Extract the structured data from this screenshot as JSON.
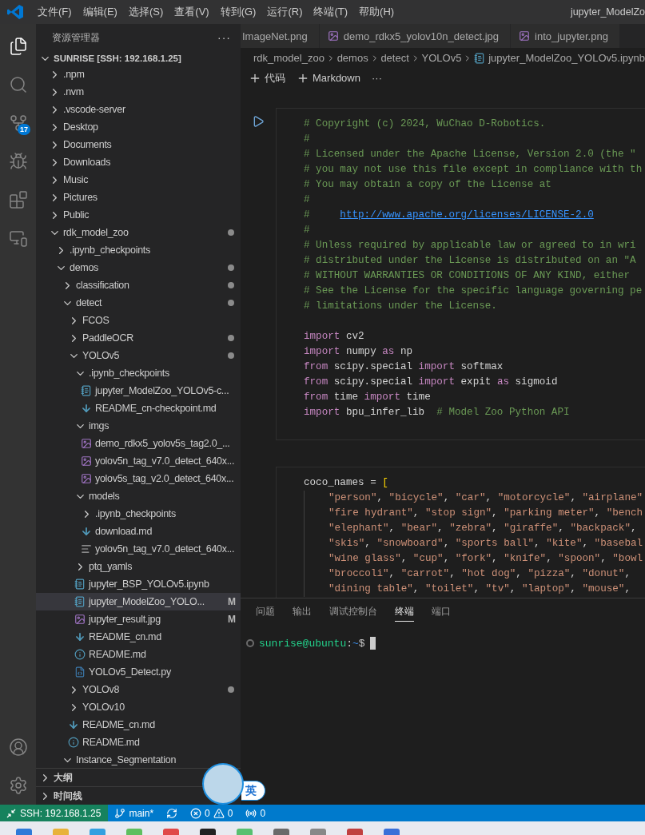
{
  "title_bar": {
    "menus": [
      "文件(F)",
      "编辑(E)",
      "选择(S)",
      "查看(V)",
      "转到(G)",
      "运行(R)",
      "终端(T)",
      "帮助(H)"
    ],
    "title": "jupyter_ModelZo"
  },
  "activity_bar": {
    "top": [
      {
        "kind": "explorer",
        "selected": true
      },
      {
        "kind": "search",
        "selected": false
      },
      {
        "kind": "source-control",
        "selected": false,
        "badge": "17"
      },
      {
        "kind": "run-debug",
        "selected": false
      },
      {
        "kind": "extensions",
        "selected": false
      },
      {
        "kind": "remote",
        "selected": false
      }
    ],
    "bottom": [
      {
        "kind": "account",
        "selected": false
      },
      {
        "kind": "settings",
        "selected": false
      }
    ]
  },
  "sidebar": {
    "title": "资源管理器",
    "more": "···",
    "section": "SUNRISE [SSH: 192.168.1.25]",
    "tree": [
      {
        "name": ".npm",
        "kind": "folder",
        "expanded": false,
        "modified": false,
        "selected": false
      },
      {
        "name": ".nvm",
        "kind": "folder",
        "expanded": false,
        "modified": false,
        "selected": false
      },
      {
        "name": ".vscode-server",
        "kind": "folder",
        "expanded": false,
        "modified": false,
        "selected": false
      },
      {
        "name": "Desktop",
        "kind": "folder",
        "expanded": false,
        "modified": false,
        "selected": false
      },
      {
        "name": "Documents",
        "kind": "folder",
        "expanded": false,
        "modified": false,
        "selected": false
      },
      {
        "name": "Downloads",
        "kind": "folder",
        "expanded": false,
        "modified": false,
        "selected": false
      },
      {
        "name": "Music",
        "kind": "folder",
        "expanded": false,
        "modified": false,
        "selected": false
      },
      {
        "name": "Pictures",
        "kind": "folder",
        "expanded": false,
        "modified": false,
        "selected": false
      },
      {
        "name": "Public",
        "kind": "folder",
        "expanded": false,
        "modified": false,
        "selected": false
      },
      {
        "name": "rdk_model_zoo",
        "kind": "folder",
        "expanded": true,
        "modified": true,
        "selected": false,
        "children": [
          {
            "name": ".ipynb_checkpoints",
            "kind": "folder",
            "expanded": false,
            "modified": false,
            "selected": false
          },
          {
            "name": "demos",
            "kind": "folder",
            "expanded": true,
            "modified": true,
            "selected": false,
            "children": [
              {
                "name": "classification",
                "kind": "folder",
                "expanded": false,
                "modified": true,
                "selected": false
              },
              {
                "name": "detect",
                "kind": "folder",
                "expanded": true,
                "modified": true,
                "selected": false,
                "children": [
                  {
                    "name": "FCOS",
                    "kind": "folder",
                    "expanded": false,
                    "modified": false,
                    "selected": false
                  },
                  {
                    "name": "PaddleOCR",
                    "kind": "folder",
                    "expanded": false,
                    "modified": true,
                    "selected": false
                  },
                  {
                    "name": "YOLOv5",
                    "kind": "folder",
                    "expanded": true,
                    "modified": true,
                    "selected": false,
                    "children": [
                      {
                        "name": ".ipynb_checkpoints",
                        "kind": "folder",
                        "expanded": true,
                        "modified": false,
                        "selected": false,
                        "children": [
                          {
                            "name": "jupyter_ModelZoo_YOLOv5-c...",
                            "kind": "notebook",
                            "modified": false,
                            "selected": false
                          },
                          {
                            "name": "README_cn-checkpoint.md",
                            "kind": "markdown",
                            "modified": false,
                            "selected": false
                          }
                        ]
                      },
                      {
                        "name": "imgs",
                        "kind": "folder",
                        "expanded": true,
                        "modified": false,
                        "selected": false,
                        "children": [
                          {
                            "name": "demo_rdkx5_yolov5s_tag2.0_...",
                            "kind": "image",
                            "modified": false,
                            "selected": false
                          },
                          {
                            "name": "yolov5n_tag_v7.0_detect_640x...",
                            "kind": "image",
                            "modified": false,
                            "selected": false
                          },
                          {
                            "name": "yolov5s_tag_v2.0_detect_640x...",
                            "kind": "image",
                            "modified": false,
                            "selected": false
                          }
                        ]
                      },
                      {
                        "name": "models",
                        "kind": "folder",
                        "expanded": true,
                        "modified": false,
                        "selected": false,
                        "children": [
                          {
                            "name": ".ipynb_checkpoints",
                            "kind": "folder",
                            "expanded": false,
                            "modified": false,
                            "selected": false
                          },
                          {
                            "name": "download.md",
                            "kind": "markdown",
                            "modified": false,
                            "selected": false
                          },
                          {
                            "name": "yolov5n_tag_v7.0_detect_640x...",
                            "kind": "text",
                            "modified": false,
                            "selected": false
                          }
                        ]
                      },
                      {
                        "name": "ptq_yamls",
                        "kind": "folder",
                        "expanded": false,
                        "modified": false,
                        "selected": false
                      },
                      {
                        "name": "jupyter_BSP_YOLOv5.ipynb",
                        "kind": "notebook",
                        "modified": false,
                        "selected": false
                      },
                      {
                        "name": "jupyter_ModelZoo_YOLO...",
                        "kind": "notebook",
                        "modified": false,
                        "selected": true,
                        "badge": "M"
                      },
                      {
                        "name": "jupyter_result.jpg",
                        "kind": "image",
                        "modified": false,
                        "selected": false,
                        "badge": "M"
                      },
                      {
                        "name": "README_cn.md",
                        "kind": "markdown",
                        "modified": false,
                        "selected": false
                      },
                      {
                        "name": "README.md",
                        "kind": "info",
                        "modified": false,
                        "selected": false
                      },
                      {
                        "name": "YOLOv5_Detect.py",
                        "kind": "python",
                        "modified": false,
                        "selected": false
                      }
                    ]
                  },
                  {
                    "name": "YOLOv8",
                    "kind": "folder",
                    "expanded": false,
                    "modified": true,
                    "selected": false
                  },
                  {
                    "name": "YOLOv10",
                    "kind": "folder",
                    "expanded": false,
                    "modified": false,
                    "selected": false
                  },
                  {
                    "name": "README_cn.md",
                    "kind": "markdown",
                    "modified": false,
                    "selected": false
                  },
                  {
                    "name": "README.md",
                    "kind": "info",
                    "modified": false,
                    "selected": false
                  }
                ]
              },
              {
                "name": "Instance_Segmentation",
                "kind": "folder",
                "expanded": true,
                "modified": false,
                "selected": false
              }
            ]
          }
        ]
      }
    ],
    "bottom_sections": [
      "大纲",
      "时间线"
    ]
  },
  "editor": {
    "tabs": [
      {
        "label": "ImageNet.png",
        "kind": "cut",
        "selected": false
      },
      {
        "label": "demo_rdkx5_yolov10n_detect.jpg",
        "kind": "image",
        "selected": false
      },
      {
        "label": "into_jupyter.png",
        "kind": "image",
        "selected": false
      }
    ],
    "breadcrumbs": [
      "rdk_model_zoo",
      "demos",
      "detect",
      "YOLOv5",
      "jupyter_ModelZoo_YOLOv5.ipynb"
    ],
    "toolbar": [
      "代码",
      "Markdown",
      "···"
    ],
    "cells": [
      {
        "lines": [
          {
            "kind": "top",
            "tokens": [
              {
                "kind": "comment",
                "t": "# Copyright (c) 2024, WuChao D-Robotics."
              }
            ]
          },
          {
            "kind": "top",
            "tokens": [
              {
                "kind": "comment",
                "t": "#"
              }
            ]
          },
          {
            "kind": "top",
            "tokens": [
              {
                "kind": "comment",
                "t": "# Licensed under the Apache License, Version 2.0 (the \""
              }
            ]
          },
          {
            "kind": "top",
            "tokens": [
              {
                "kind": "comment",
                "t": "# you may not use this file except in compliance with th"
              }
            ]
          },
          {
            "kind": "top",
            "tokens": [
              {
                "kind": "comment",
                "t": "# You may obtain a copy of the License at"
              }
            ]
          },
          {
            "kind": "top",
            "tokens": [
              {
                "kind": "comment",
                "t": "#"
              }
            ]
          },
          {
            "kind": "top",
            "tokens": [
              {
                "kind": "comment",
                "t": "#     "
              },
              {
                "kind": "link",
                "t": "http://www.apache.org/licenses/LICENSE-2.0"
              }
            ]
          },
          {
            "kind": "top",
            "tokens": [
              {
                "kind": "comment",
                "t": "#"
              }
            ]
          },
          {
            "kind": "top",
            "tokens": [
              {
                "kind": "comment",
                "t": "# Unless required by applicable law or agreed to in wri"
              }
            ]
          },
          {
            "kind": "top",
            "tokens": [
              {
                "kind": "comment",
                "t": "# distributed under the License is distributed on an \"A"
              }
            ]
          },
          {
            "kind": "top",
            "tokens": [
              {
                "kind": "comment",
                "t": "# WITHOUT WARRANTIES OR CONDITIONS OF ANY KIND, either"
              }
            ]
          },
          {
            "kind": "top",
            "tokens": [
              {
                "kind": "comment",
                "t": "# See the License for the specific language governing pe"
              }
            ]
          },
          {
            "kind": "top",
            "tokens": [
              {
                "kind": "comment",
                "t": "# limitations under the License."
              }
            ]
          },
          {
            "kind": "blank"
          },
          {
            "kind": "top",
            "tokens": [
              {
                "kind": "keyword",
                "t": "import"
              },
              {
                "kind": "plain",
                "t": " cv2"
              }
            ]
          },
          {
            "kind": "top",
            "tokens": [
              {
                "kind": "keyword",
                "t": "import"
              },
              {
                "kind": "plain",
                "t": " numpy "
              },
              {
                "kind": "keyword",
                "t": "as"
              },
              {
                "kind": "plain",
                "t": " np"
              }
            ]
          },
          {
            "kind": "top",
            "tokens": [
              {
                "kind": "keyword",
                "t": "from"
              },
              {
                "kind": "plain",
                "t": " scipy.special "
              },
              {
                "kind": "keyword",
                "t": "import"
              },
              {
                "kind": "plain",
                "t": " softmax"
              }
            ]
          },
          {
            "kind": "top",
            "tokens": [
              {
                "kind": "keyword",
                "t": "from"
              },
              {
                "kind": "plain",
                "t": " scipy.special "
              },
              {
                "kind": "keyword",
                "t": "import"
              },
              {
                "kind": "plain",
                "t": " expit "
              },
              {
                "kind": "keyword",
                "t": "as"
              },
              {
                "kind": "plain",
                "t": " sigmoid"
              }
            ]
          },
          {
            "kind": "top",
            "tokens": [
              {
                "kind": "keyword",
                "t": "from"
              },
              {
                "kind": "plain",
                "t": " time "
              },
              {
                "kind": "keyword",
                "t": "import"
              },
              {
                "kind": "plain",
                "t": " time"
              }
            ]
          },
          {
            "kind": "top",
            "tokens": [
              {
                "kind": "keyword",
                "t": "import"
              },
              {
                "kind": "plain",
                "t": " bpu_infer_lib  "
              },
              {
                "kind": "comment",
                "t": "# Model Zoo Python API"
              }
            ]
          }
        ]
      },
      {
        "lines": [
          {
            "kind": "top",
            "tokens": [
              {
                "kind": "plain",
                "t": "coco_names = "
              },
              {
                "kind": "bracket",
                "t": "["
              }
            ]
          },
          {
            "kind": "inner",
            "tokens": [
              {
                "kind": "string",
                "t": "\"person\""
              },
              {
                "kind": "plain",
                "t": ", "
              },
              {
                "kind": "string",
                "t": "\"bicycle\""
              },
              {
                "kind": "plain",
                "t": ", "
              },
              {
                "kind": "string",
                "t": "\"car\""
              },
              {
                "kind": "plain",
                "t": ", "
              },
              {
                "kind": "string",
                "t": "\"motorcycle\""
              },
              {
                "kind": "plain",
                "t": ", "
              },
              {
                "kind": "string",
                "t": "\"airplane\""
              }
            ]
          },
          {
            "kind": "inner",
            "tokens": [
              {
                "kind": "string",
                "t": "\"fire hydrant\""
              },
              {
                "kind": "plain",
                "t": ", "
              },
              {
                "kind": "string",
                "t": "\"stop sign\""
              },
              {
                "kind": "plain",
                "t": ", "
              },
              {
                "kind": "string",
                "t": "\"parking meter\""
              },
              {
                "kind": "plain",
                "t": ", "
              },
              {
                "kind": "string",
                "t": "\"bench"
              }
            ]
          },
          {
            "kind": "inner",
            "tokens": [
              {
                "kind": "string",
                "t": "\"elephant\""
              },
              {
                "kind": "plain",
                "t": ", "
              },
              {
                "kind": "string",
                "t": "\"bear\""
              },
              {
                "kind": "plain",
                "t": ", "
              },
              {
                "kind": "string",
                "t": "\"zebra\""
              },
              {
                "kind": "plain",
                "t": ", "
              },
              {
                "kind": "string",
                "t": "\"giraffe\""
              },
              {
                "kind": "plain",
                "t": ", "
              },
              {
                "kind": "string",
                "t": "\"backpack\""
              },
              {
                "kind": "plain",
                "t": ","
              }
            ]
          },
          {
            "kind": "inner",
            "tokens": [
              {
                "kind": "string",
                "t": "\"skis\""
              },
              {
                "kind": "plain",
                "t": ", "
              },
              {
                "kind": "string",
                "t": "\"snowboard\""
              },
              {
                "kind": "plain",
                "t": ", "
              },
              {
                "kind": "string",
                "t": "\"sports ball\""
              },
              {
                "kind": "plain",
                "t": ", "
              },
              {
                "kind": "string",
                "t": "\"kite\""
              },
              {
                "kind": "plain",
                "t": ", "
              },
              {
                "kind": "string",
                "t": "\"basebal"
              }
            ]
          },
          {
            "kind": "inner",
            "tokens": [
              {
                "kind": "string",
                "t": "\"wine glass\""
              },
              {
                "kind": "plain",
                "t": ", "
              },
              {
                "kind": "string",
                "t": "\"cup\""
              },
              {
                "kind": "plain",
                "t": ", "
              },
              {
                "kind": "string",
                "t": "\"fork\""
              },
              {
                "kind": "plain",
                "t": ", "
              },
              {
                "kind": "string",
                "t": "\"knife\""
              },
              {
                "kind": "plain",
                "t": ", "
              },
              {
                "kind": "string",
                "t": "\"spoon\""
              },
              {
                "kind": "plain",
                "t": ", "
              },
              {
                "kind": "string",
                "t": "\"bowl"
              }
            ]
          },
          {
            "kind": "inner",
            "tokens": [
              {
                "kind": "string",
                "t": "\"broccoli\""
              },
              {
                "kind": "plain",
                "t": ", "
              },
              {
                "kind": "string",
                "t": "\"carrot\""
              },
              {
                "kind": "plain",
                "t": ", "
              },
              {
                "kind": "string",
                "t": "\"hot dog\""
              },
              {
                "kind": "plain",
                "t": ", "
              },
              {
                "kind": "string",
                "t": "\"pizza\""
              },
              {
                "kind": "plain",
                "t": ", "
              },
              {
                "kind": "string",
                "t": "\"donut\""
              },
              {
                "kind": "plain",
                "t": ","
              }
            ]
          },
          {
            "kind": "inner",
            "tokens": [
              {
                "kind": "string",
                "t": "\"dining table\""
              },
              {
                "kind": "plain",
                "t": ", "
              },
              {
                "kind": "string",
                "t": "\"toilet\""
              },
              {
                "kind": "plain",
                "t": ", "
              },
              {
                "kind": "string",
                "t": "\"tv\""
              },
              {
                "kind": "plain",
                "t": ", "
              },
              {
                "kind": "string",
                "t": "\"laptop\""
              },
              {
                "kind": "plain",
                "t": ", "
              },
              {
                "kind": "string",
                "t": "\"mouse\""
              },
              {
                "kind": "plain",
                "t": ","
              }
            ]
          }
        ]
      }
    ]
  },
  "panel": {
    "tabs": [
      {
        "label": "问题",
        "selected": false
      },
      {
        "label": "输出",
        "selected": false
      },
      {
        "label": "调试控制台",
        "selected": false
      },
      {
        "label": "终端",
        "selected": true
      },
      {
        "label": "端口",
        "selected": false
      }
    ],
    "terminal": {
      "user_host": "sunrise@ubuntu",
      "separator": ":",
      "path": "~",
      "symbol": "$"
    }
  },
  "ime": {
    "label": "英"
  },
  "status_bar": {
    "remote": "SSH: 192.168.1.25",
    "branch": "main*",
    "errors": "0",
    "warnings": "0",
    "ports": "0"
  }
}
